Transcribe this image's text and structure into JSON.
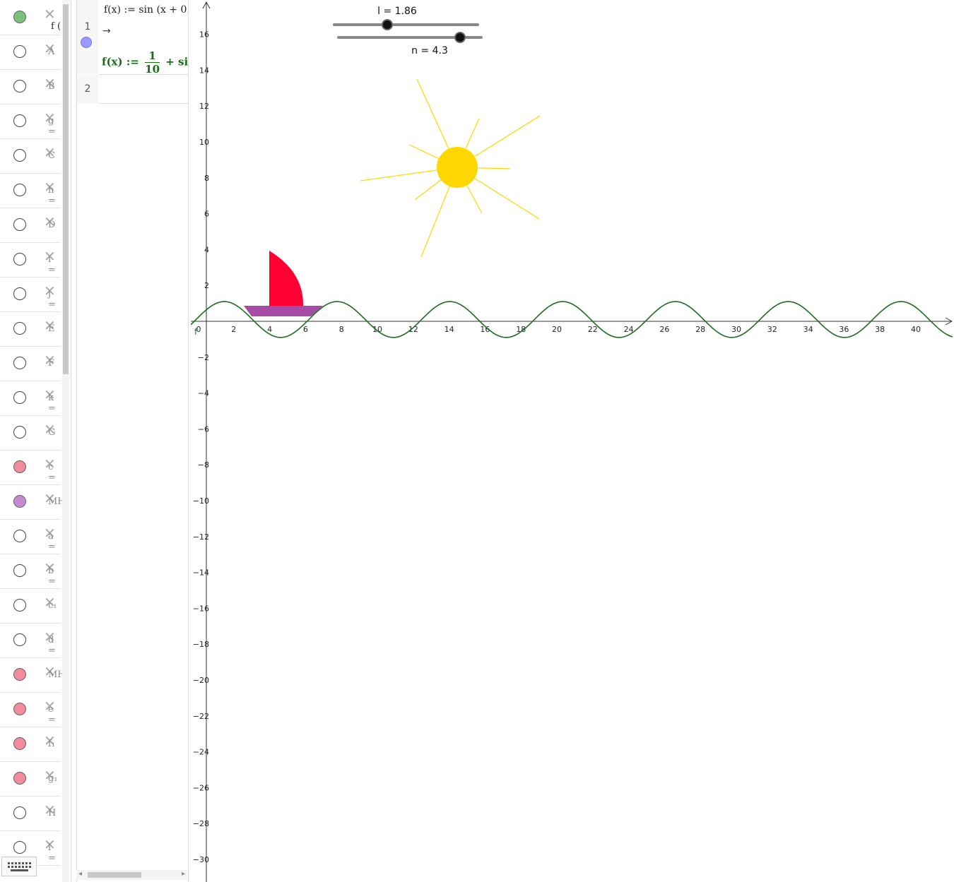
{
  "algebra_view": {
    "rows": [
      {
        "label": "f (",
        "dot_color": "#7cbf7c"
      },
      {
        "label": "A",
        "dot_color": "#ffffff"
      },
      {
        "label": "B",
        "dot_color": "#ffffff"
      },
      {
        "label": "g =",
        "dot_color": "#ffffff"
      },
      {
        "label": "C",
        "dot_color": "#ffffff"
      },
      {
        "label": "h =",
        "dot_color": "#ffffff"
      },
      {
        "label": "D",
        "dot_color": "#ffffff"
      },
      {
        "label": "i =",
        "dot_color": "#ffffff"
      },
      {
        "label": "j =",
        "dot_color": "#ffffff"
      },
      {
        "label": "E",
        "dot_color": "#ffffff"
      },
      {
        "label": "F",
        "dot_color": "#ffffff"
      },
      {
        "label": "k =",
        "dot_color": "#ffffff"
      },
      {
        "label": "G",
        "dot_color": "#ffffff"
      },
      {
        "label": "c =",
        "dot_color": "#f28b9b"
      },
      {
        "label": "MH",
        "dot_color": "#c58bd2"
      },
      {
        "label": "a =",
        "dot_color": "#ffffff"
      },
      {
        "label": "b =",
        "dot_color": "#ffffff"
      },
      {
        "label": "c₁",
        "dot_color": "#ffffff"
      },
      {
        "label": "d =",
        "dot_color": "#ffffff"
      },
      {
        "label": "MH",
        "dot_color": "#f28b9b"
      },
      {
        "label": "e =",
        "dot_color": "#f28b9b"
      },
      {
        "label": "f₁",
        "dot_color": "#f28b9b"
      },
      {
        "label": "g₁",
        "dot_color": "#f28b9b"
      },
      {
        "label": "H",
        "dot_color": "#ffffff"
      },
      {
        "label": "l =",
        "dot_color": "#ffffff"
      }
    ]
  },
  "cas_view": {
    "row1_number": "1",
    "row1_input": "f(x) := sin (x + 0.",
    "row1_arrow": "→",
    "row1_output_prefix": "f(x) :=",
    "row1_output_num": "1",
    "row1_output_den": "10",
    "row1_output_suffix": "+ si",
    "row2_number": "2"
  },
  "sliders": {
    "l_label": "l = 1.86",
    "n_label": "n = 4.3",
    "l_value": 1.86,
    "n_value": 4.3
  },
  "colors": {
    "curve": "#1a6e1a",
    "sun": "#ffd700",
    "sail": "#ff0033",
    "hull": "#a64ca6"
  },
  "chart_data": {
    "type": "line",
    "x_ticks": [
      "0",
      "2",
      "4",
      "6",
      "8",
      "10",
      "12",
      "14",
      "16",
      "18",
      "20",
      "22",
      "24",
      "26",
      "28",
      "30",
      "32",
      "34",
      "36",
      "38",
      "40"
    ],
    "y_ticks": [
      "16",
      "14",
      "12",
      "10",
      "8",
      "6",
      "4",
      "2",
      "−2",
      "−4",
      "−6",
      "−8",
      "−10",
      "−12",
      "−14",
      "−16",
      "−18",
      "−20",
      "−22",
      "−24",
      "−26",
      "−28",
      "−30"
    ],
    "axis_origin_label": "0",
    "curve_label": "f"
  }
}
